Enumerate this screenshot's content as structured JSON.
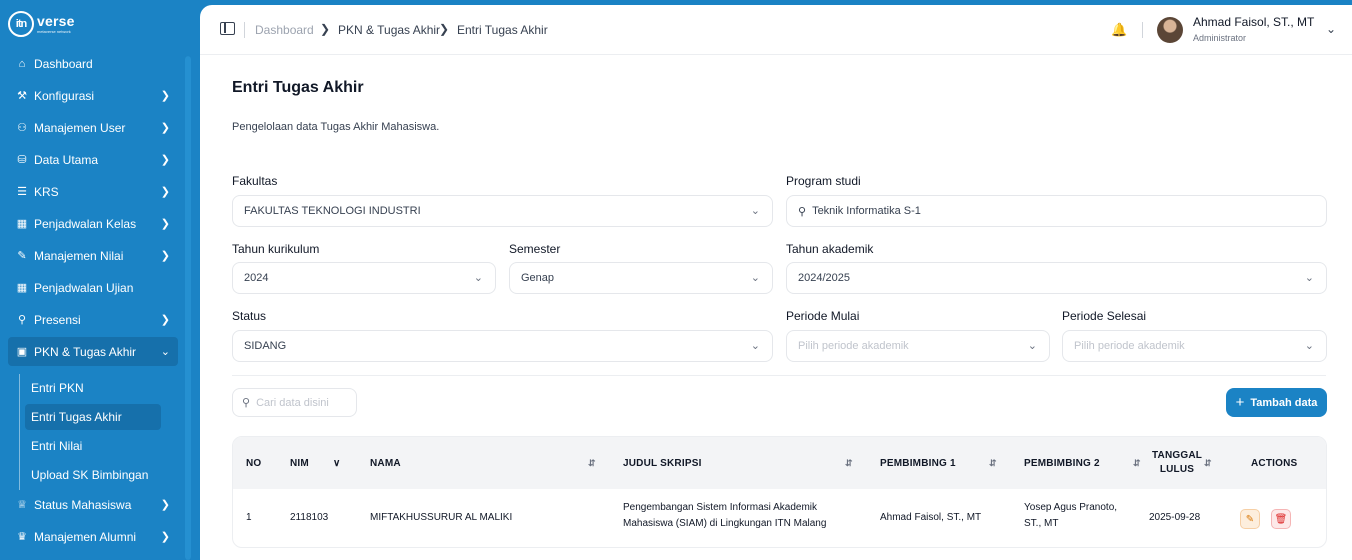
{
  "brand": {
    "mark": "itn",
    "word": "verse",
    "sub": "metaverse network"
  },
  "sidebar": {
    "items": [
      {
        "label": "Dashboard",
        "icon": "home-icon",
        "glyph": "⌂"
      },
      {
        "label": "Konfigurasi",
        "icon": "wrench-icon",
        "glyph": "⚒"
      },
      {
        "label": "Manajemen User",
        "icon": "users-icon",
        "glyph": "⚇"
      },
      {
        "label": "Data Utama",
        "icon": "database-icon",
        "glyph": "⛁"
      },
      {
        "label": "KRS",
        "icon": "list-icon",
        "glyph": "☰"
      },
      {
        "label": "Penjadwalan Kelas",
        "icon": "calendar-icon",
        "glyph": "▦"
      },
      {
        "label": "Manajemen Nilai",
        "icon": "edit-icon",
        "glyph": "✎"
      },
      {
        "label": "Penjadwalan Ujian",
        "icon": "calendar-icon",
        "glyph": "▦"
      },
      {
        "label": "Presensi",
        "icon": "user-check-icon",
        "glyph": "⚲"
      },
      {
        "label": "PKN & Tugas Akhir",
        "icon": "briefcase-icon",
        "glyph": "▣"
      },
      {
        "label": "Status Mahasiswa",
        "icon": "graduation-cap-icon",
        "glyph": "♕"
      },
      {
        "label": "Manajemen Alumni",
        "icon": "user-graduate-icon",
        "glyph": "♛"
      }
    ],
    "subitems": [
      "Entri PKN",
      "Entri Tugas Akhir",
      "Entri Nilai",
      "Upload SK Bimbingan"
    ]
  },
  "breadcrumb": {
    "home": "Dashboard",
    "section": "PKN & Tugas Akhir",
    "current": "Entri Tugas Akhir"
  },
  "user": {
    "name": "Ahmad Faisol, ST., MT",
    "role": "Administrator"
  },
  "page": {
    "title": "Entri Tugas Akhir",
    "description": "Pengelolaan data Tugas Akhir Mahasiswa."
  },
  "filters": {
    "fakultas": {
      "label": "Fakultas",
      "value": "FAKULTAS TEKNOLOGI INDUSTRI"
    },
    "prodi": {
      "label": "Program studi",
      "value": "Teknik Informatika S-1"
    },
    "kurikulum": {
      "label": "Tahun kurikulum",
      "value": "2024"
    },
    "semester": {
      "label": "Semester",
      "value": "Genap"
    },
    "akademik": {
      "label": "Tahun akademik",
      "value": "2024/2025"
    },
    "status": {
      "label": "Status",
      "value": "SIDANG"
    },
    "mulai": {
      "label": "Periode Mulai",
      "placeholder": "Pilih periode akademik"
    },
    "selesai": {
      "label": "Periode Selesai",
      "placeholder": "Pilih periode akademik"
    }
  },
  "search": {
    "placeholder": "Cari data disini"
  },
  "add_button": "Tambah data",
  "table": {
    "headers": {
      "no": "NO",
      "nim": "NIM",
      "nama": "NAMA",
      "judul": "JUDUL SKRIPSI",
      "p1": "PEMBIMBING 1",
      "p2": "PEMBIMBING 2",
      "tgl1": "TANGGAL",
      "tgl2": "LULUS",
      "actions": "ACTIONS"
    },
    "rows": [
      {
        "no": "1",
        "nim": "2118103",
        "nama": "MIFTAKHUSSURUR AL MALIKI",
        "judul1": "Pengembangan Sistem Informasi Akademik",
        "judul2": "Mahasiswa (SIAM) di Lingkungan ITN Malang",
        "p1": "Ahmad Faisol, ST., MT",
        "p2a": "Yosep Agus Pranoto,",
        "p2b": "ST., MT",
        "tanggal": "2025-09-28"
      }
    ]
  },
  "colors": {
    "primary": "#1b83c5",
    "sidebar_active": "#1670ab"
  }
}
